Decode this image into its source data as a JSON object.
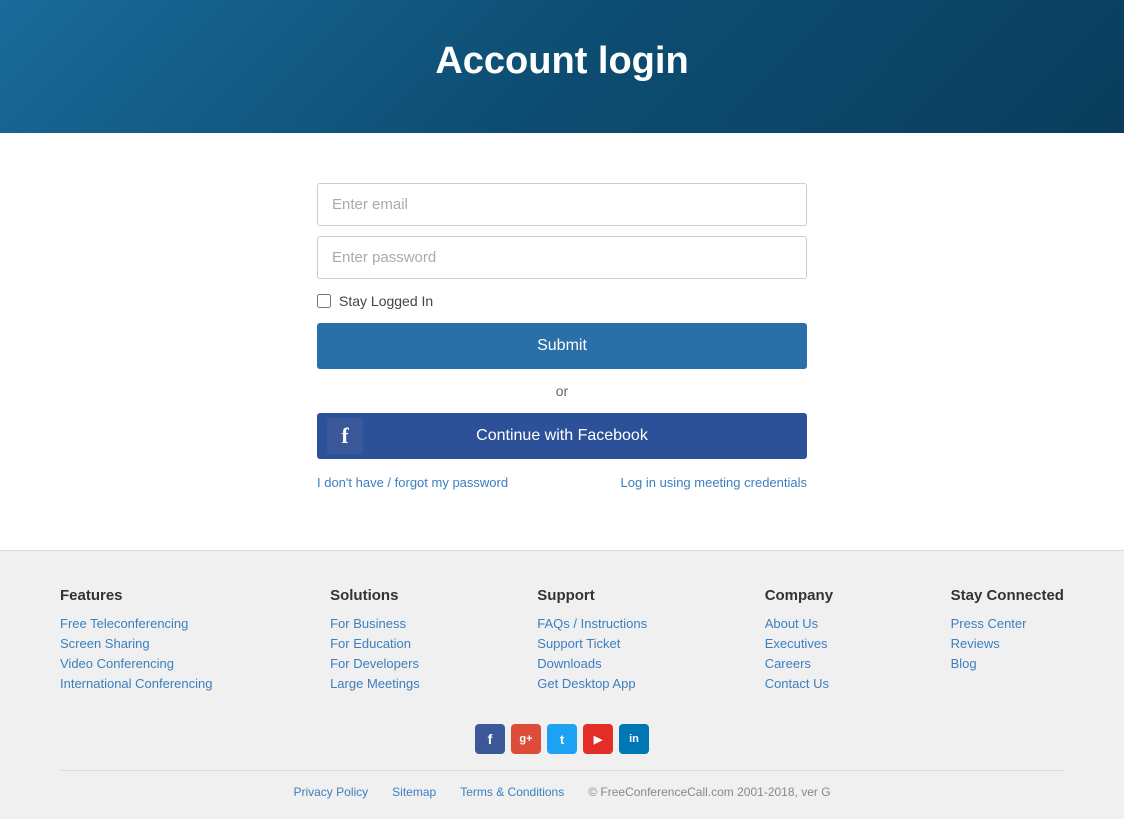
{
  "header": {
    "title": "Account login"
  },
  "form": {
    "email_placeholder": "Enter email",
    "password_placeholder": "Enter password",
    "stay_logged_in_label": "Stay Logged In",
    "submit_label": "Submit",
    "or_text": "or",
    "facebook_button_label": "Continue with Facebook",
    "forgot_password_link": "I don't have / forgot my password",
    "meeting_credentials_link": "Log in using meeting credentials"
  },
  "footer": {
    "columns": [
      {
        "heading": "Features",
        "links": [
          "Free Teleconferencing",
          "Screen Sharing",
          "Video Conferencing",
          "International Conferencing"
        ]
      },
      {
        "heading": "Solutions",
        "links": [
          "For Business",
          "For Education",
          "For Developers",
          "Large Meetings"
        ]
      },
      {
        "heading": "Support",
        "links": [
          "FAQs / Instructions",
          "Support Ticket",
          "Downloads",
          "Get Desktop App"
        ]
      },
      {
        "heading": "Company",
        "links": [
          "About Us",
          "Executives",
          "Careers",
          "Contact Us"
        ]
      },
      {
        "heading": "Stay Connected",
        "links": [
          "Press Center",
          "Reviews",
          "Blog"
        ]
      }
    ],
    "social_icons": [
      "f",
      "g+",
      "t",
      "▶",
      "in"
    ],
    "bottom_links": [
      "Privacy Policy",
      "Sitemap",
      "Terms & Conditions"
    ],
    "copyright": "© FreeConferenceCall.com 2001-2018, ver G"
  }
}
